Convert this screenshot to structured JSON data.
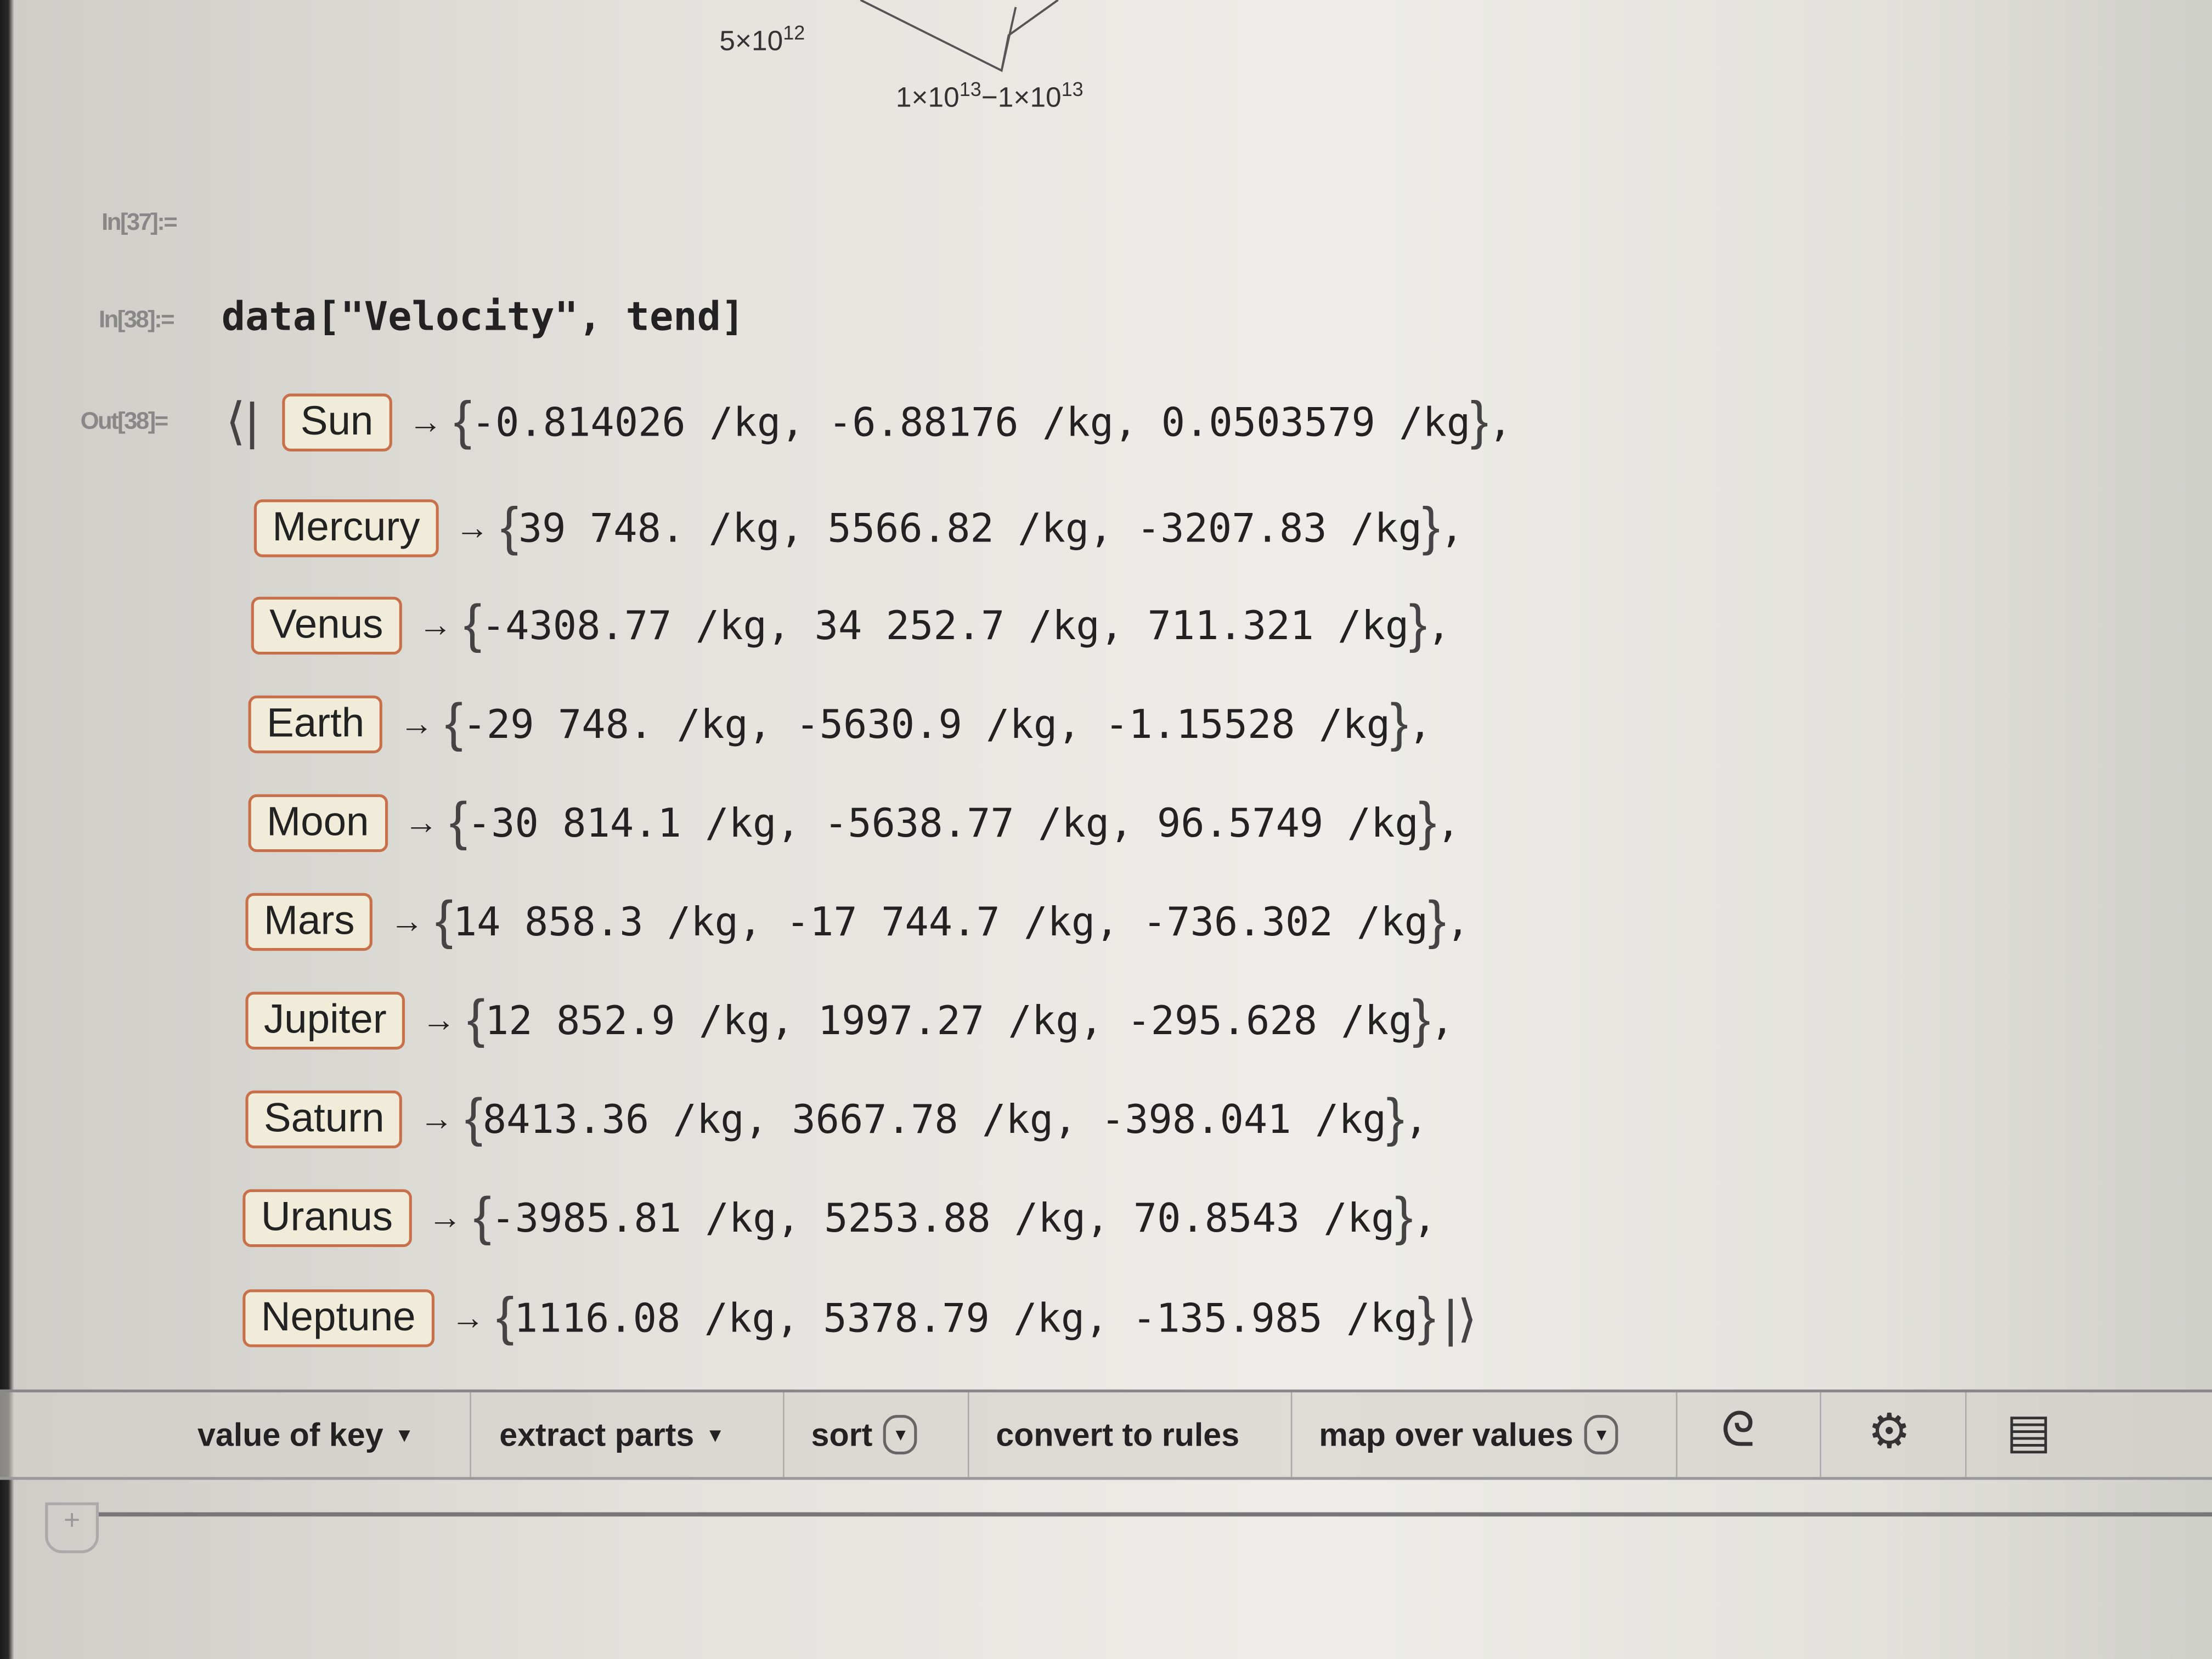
{
  "plot_ticks": {
    "tick_a": "5×10",
    "tick_a_exp": "12",
    "tick_b": "1×10",
    "tick_b_exp": "13",
    "tick_c": "−1×10",
    "tick_c_exp": "13"
  },
  "cells": {
    "in37_label": "In[37]:=",
    "in38_label": "In[38]:=",
    "in38_code": "data[\"Velocity\", tend]",
    "out38_label": "Out[38]="
  },
  "association": {
    "open": "⟨|",
    "close": "|⟩",
    "arrow": "→",
    "rows": [
      {
        "key": "Sun",
        "values": "-0.814026 /kg, -6.88176 /kg, 0.0503579 /kg",
        "sep": ","
      },
      {
        "key": "Mercury",
        "values": "39 748. /kg, 5566.82 /kg, -3207.83 /kg",
        "sep": ","
      },
      {
        "key": "Venus",
        "values": "-4308.77 /kg, 34 252.7 /kg, 711.321 /kg",
        "sep": ","
      },
      {
        "key": "Earth",
        "values": "-29 748. /kg, -5630.9 /kg, -1.15528 /kg",
        "sep": ","
      },
      {
        "key": "Moon",
        "values": "-30 814.1 /kg, -5638.77 /kg, 96.5749 /kg",
        "sep": ","
      },
      {
        "key": "Mars",
        "values": "14 858.3 /kg, -17 744.7 /kg, -736.302 /kg",
        "sep": ","
      },
      {
        "key": "Jupiter",
        "values": "12 852.9 /kg, 1997.27 /kg, -295.628 /kg",
        "sep": ","
      },
      {
        "key": "Saturn",
        "values": "8413.36 /kg, 3667.78 /kg, -398.041 /kg",
        "sep": ","
      },
      {
        "key": "Uranus",
        "values": "-3985.81 /kg, 5253.88 /kg, 70.8543 /kg",
        "sep": ","
      },
      {
        "key": "Neptune",
        "values": "1116.08 /kg, 5378.79 /kg, -135.985 /kg",
        "sep": ""
      }
    ]
  },
  "toolbar": {
    "value_of_key": "value of key",
    "extract_parts": "extract parts",
    "sort": "sort",
    "convert_to_rules": "convert to rules",
    "map_over_values": "map over values",
    "icons": [
      "wolfram-spiral-icon",
      "gear-icon",
      "comment-icon"
    ]
  },
  "colors": {
    "key_border": "#c8704a",
    "key_fill": "#f1ecd9"
  }
}
